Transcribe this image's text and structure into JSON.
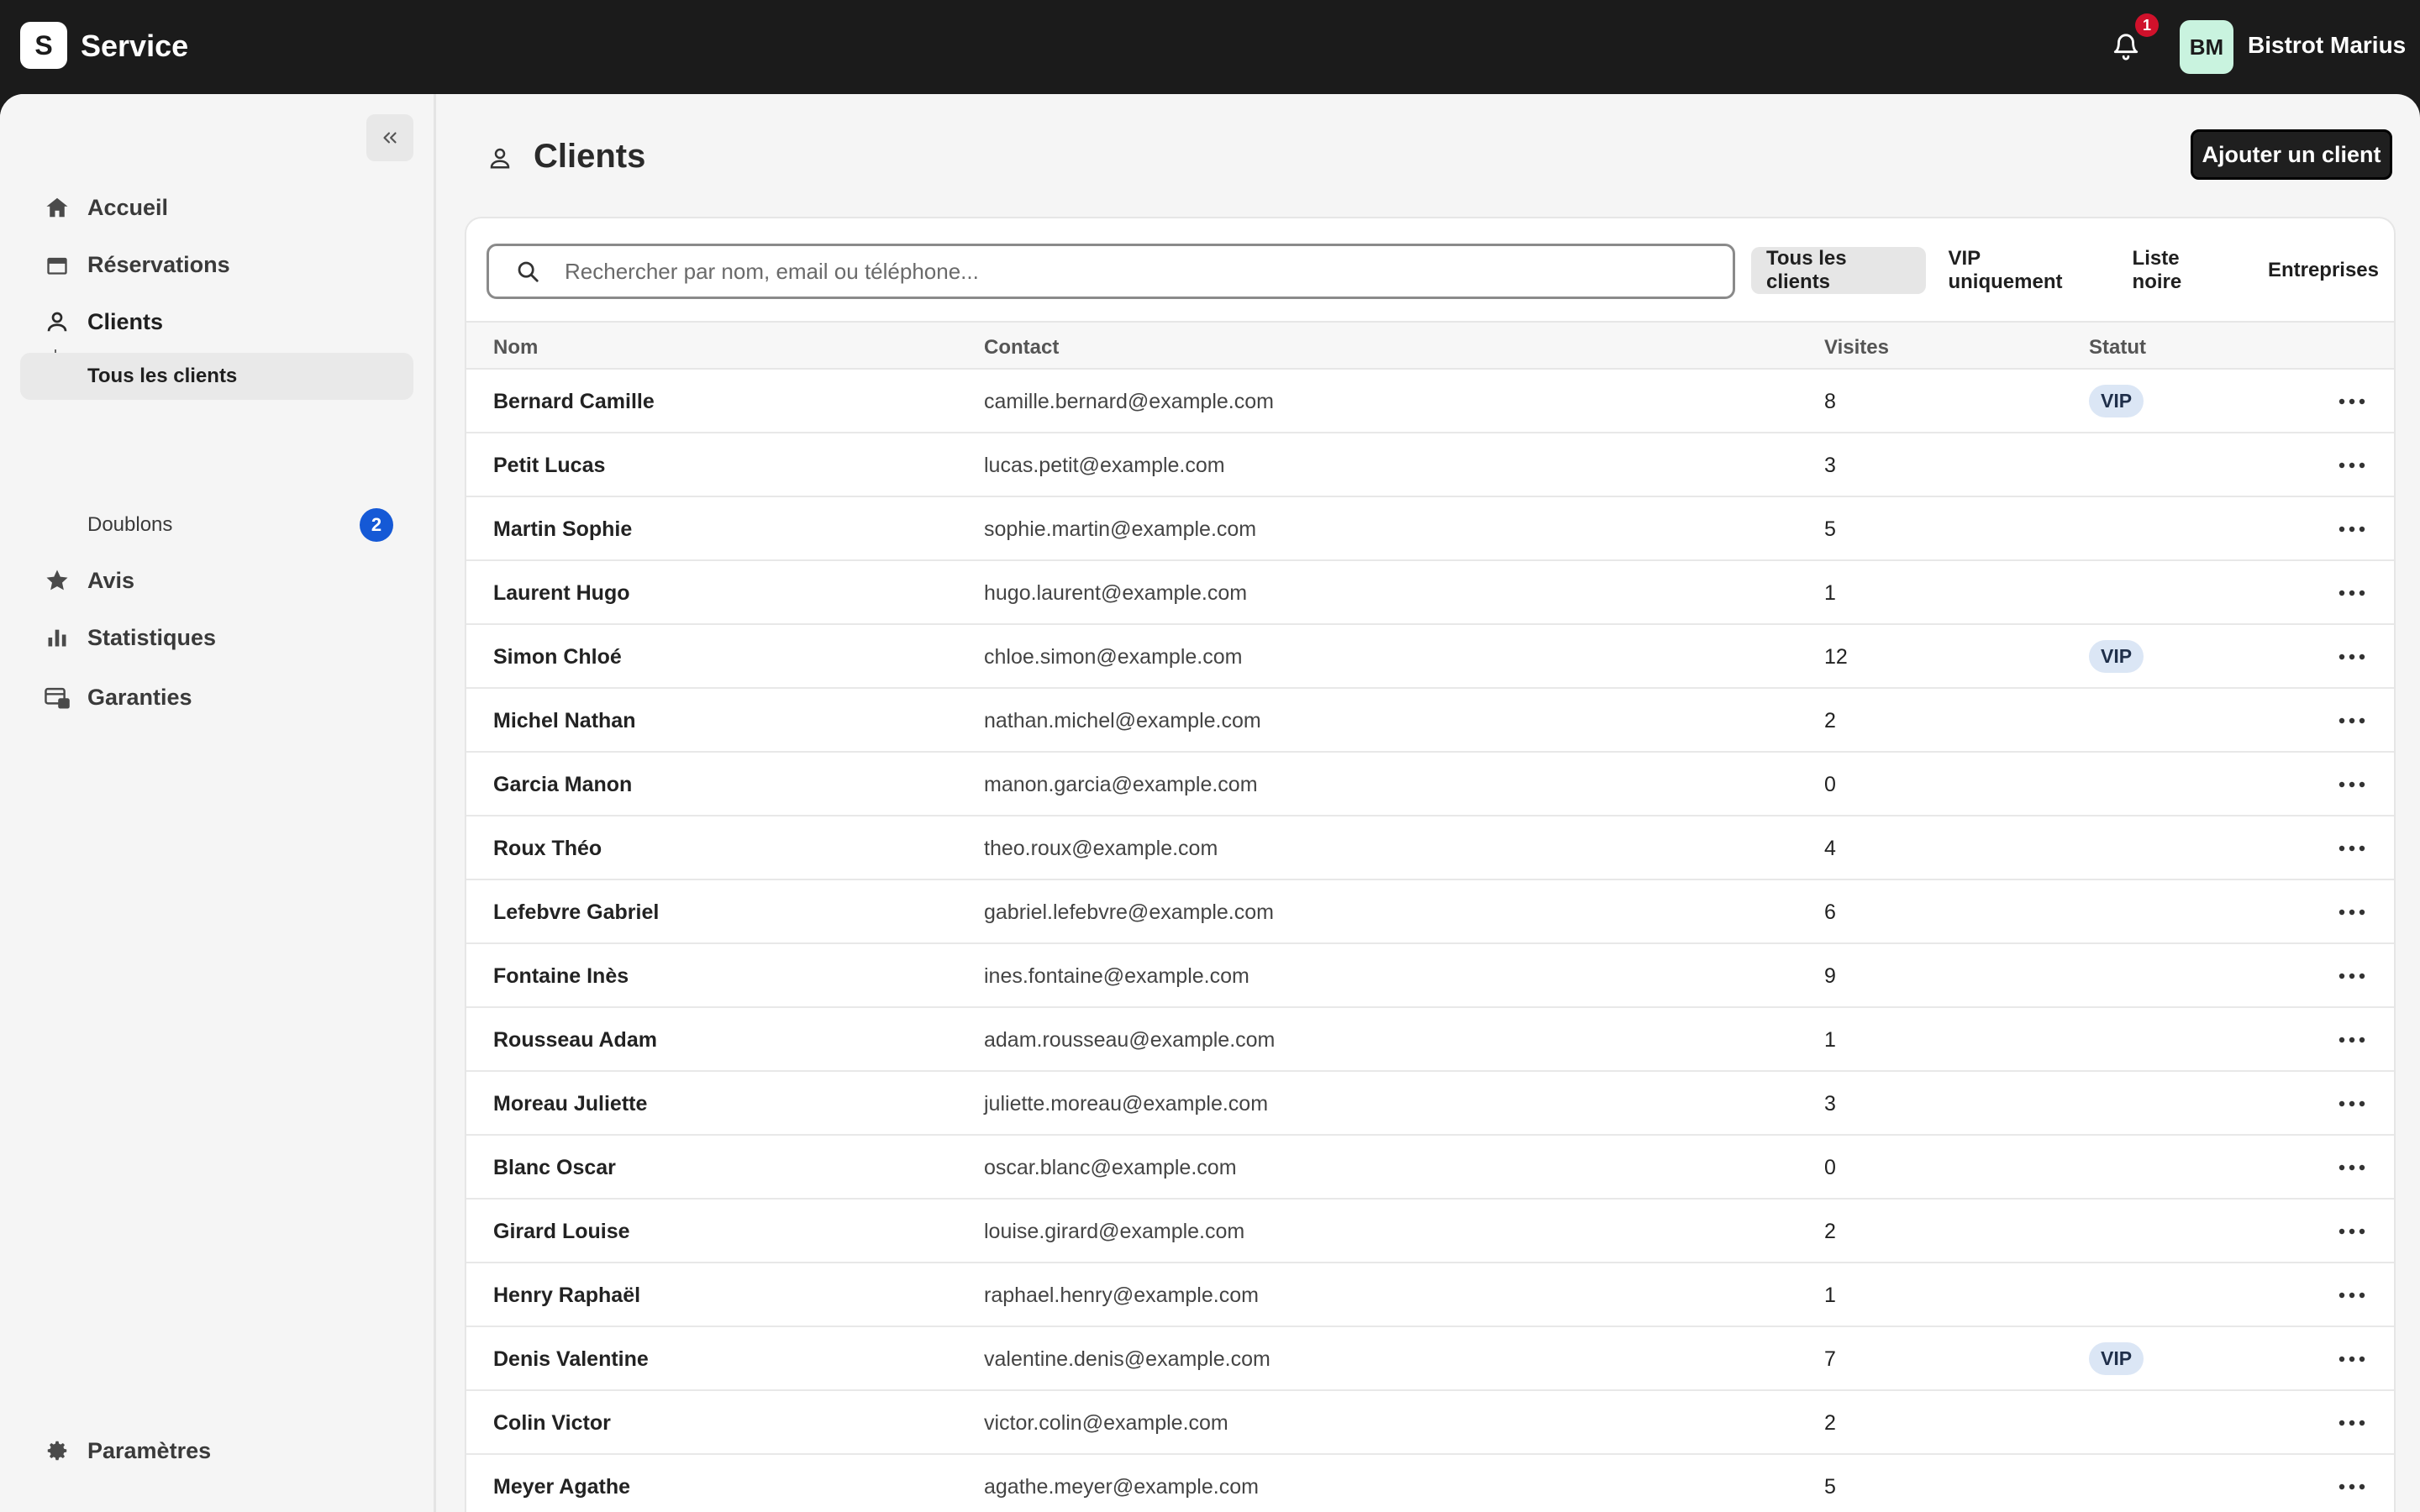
{
  "app": {
    "logo_letter": "S",
    "name": "Service"
  },
  "header": {
    "notification_count": "1",
    "avatar_initials": "BM",
    "account_name": "Bistrot Marius"
  },
  "sidebar": {
    "items": [
      {
        "label": "Accueil",
        "icon": "home-icon"
      },
      {
        "label": "Réservations",
        "icon": "calendar-icon"
      },
      {
        "label": "Clients",
        "icon": "user-icon"
      },
      {
        "label": "Avis",
        "icon": "star-icon"
      },
      {
        "label": "Statistiques",
        "icon": "bar-chart-icon"
      },
      {
        "label": "Garanties",
        "icon": "card-lock-icon"
      }
    ],
    "sub_items": [
      {
        "label": "Tous les clients",
        "active": true
      },
      {
        "label": "Doublons",
        "badge": "2"
      }
    ],
    "footer_label": "Paramètres"
  },
  "page": {
    "title": "Clients",
    "add_button": "Ajouter un client",
    "search_placeholder": "Rechercher par nom, email ou téléphone...",
    "filters": [
      "Tous les clients",
      "VIP uniquement",
      "Liste noire",
      "Entreprises"
    ],
    "active_filter": "Tous les clients"
  },
  "table": {
    "columns": [
      "Nom",
      "Contact",
      "Visites",
      "Statut"
    ],
    "rows": [
      {
        "name": "Bernard Camille",
        "contact": "camille.bernard@example.com",
        "visits": "8",
        "status": "VIP"
      },
      {
        "name": "Petit Lucas",
        "contact": "lucas.petit@example.com",
        "visits": "3",
        "status": ""
      },
      {
        "name": "Martin Sophie",
        "contact": "sophie.martin@example.com",
        "visits": "5",
        "status": ""
      },
      {
        "name": "Laurent Hugo",
        "contact": "hugo.laurent@example.com",
        "visits": "1",
        "status": ""
      },
      {
        "name": "Simon Chloé",
        "contact": "chloe.simon@example.com",
        "visits": "12",
        "status": "VIP"
      },
      {
        "name": "Michel Nathan",
        "contact": "nathan.michel@example.com",
        "visits": "2",
        "status": ""
      },
      {
        "name": "Garcia Manon",
        "contact": "manon.garcia@example.com",
        "visits": "0",
        "status": ""
      },
      {
        "name": "Roux Théo",
        "contact": "theo.roux@example.com",
        "visits": "4",
        "status": ""
      },
      {
        "name": "Lefebvre Gabriel",
        "contact": "gabriel.lefebvre@example.com",
        "visits": "6",
        "status": ""
      },
      {
        "name": "Fontaine Inès",
        "contact": "ines.fontaine@example.com",
        "visits": "9",
        "status": ""
      },
      {
        "name": "Rousseau Adam",
        "contact": "adam.rousseau@example.com",
        "visits": "1",
        "status": ""
      },
      {
        "name": "Moreau Juliette",
        "contact": "juliette.moreau@example.com",
        "visits": "3",
        "status": ""
      },
      {
        "name": "Blanc Oscar",
        "contact": "oscar.blanc@example.com",
        "visits": "0",
        "status": ""
      },
      {
        "name": "Girard Louise",
        "contact": "louise.girard@example.com",
        "visits": "2",
        "status": ""
      },
      {
        "name": "Henry Raphaël",
        "contact": "raphael.henry@example.com",
        "visits": "1",
        "status": ""
      },
      {
        "name": "Denis Valentine",
        "contact": "valentine.denis@example.com",
        "visits": "7",
        "status": "VIP"
      },
      {
        "name": "Colin Victor",
        "contact": "victor.colin@example.com",
        "visits": "2",
        "status": ""
      },
      {
        "name": "Meyer Agathe",
        "contact": "agathe.meyer@example.com",
        "visits": "5",
        "status": ""
      }
    ]
  },
  "colors": {
    "topbar": "#1b1b1b",
    "accent_badge": "#1559d6",
    "notification": "#d0112b",
    "avatar_bg": "#c9f3df",
    "vip_bg": "#dbe6f5"
  }
}
